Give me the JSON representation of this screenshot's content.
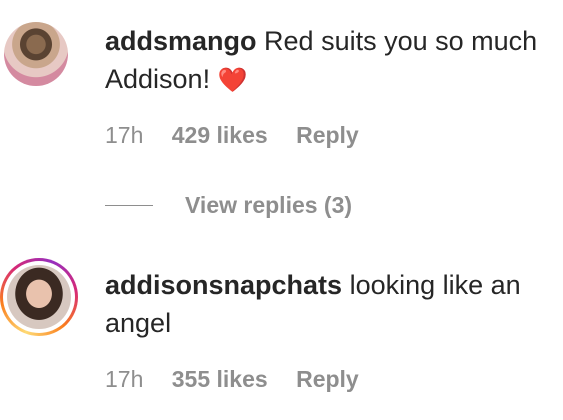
{
  "comments": [
    {
      "username": "addsmango",
      "text": "Red suits you so much Addison!",
      "emoji": "❤️",
      "time": "17h",
      "likes": "429 likes",
      "reply_label": "Reply",
      "view_replies": "View replies (3)"
    },
    {
      "username": "addisonsnapchats",
      "text": "looking like an angel",
      "time": "17h",
      "likes": "355 likes",
      "reply_label": "Reply"
    }
  ]
}
